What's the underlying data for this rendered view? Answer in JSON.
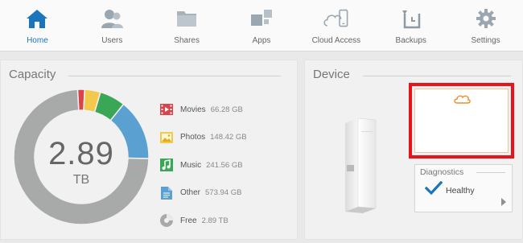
{
  "nav": [
    {
      "label": "Home",
      "icon": "home-icon",
      "active": true
    },
    {
      "label": "Users",
      "icon": "users-icon",
      "active": false
    },
    {
      "label": "Shares",
      "icon": "shares-icon",
      "active": false
    },
    {
      "label": "Apps",
      "icon": "apps-icon",
      "active": false
    },
    {
      "label": "Cloud Access",
      "icon": "cloud-access-icon",
      "active": false
    },
    {
      "label": "Backups",
      "icon": "backups-icon",
      "active": false
    },
    {
      "label": "Settings",
      "icon": "settings-icon",
      "active": false
    }
  ],
  "capacity": {
    "title": "Capacity",
    "total_value": "2.89",
    "total_unit": "TB",
    "segments": [
      {
        "name": "Movies",
        "size": "66.28 GB",
        "gb": 66.28,
        "color": "#d9434b",
        "icon": "movies-icon"
      },
      {
        "name": "Photos",
        "size": "148.42 GB",
        "gb": 148.42,
        "color": "#f2c94c",
        "icon": "photos-icon"
      },
      {
        "name": "Music",
        "size": "241.56 GB",
        "gb": 241.56,
        "color": "#3aa757",
        "icon": "music-icon"
      },
      {
        "name": "Other",
        "size": "573.94 GB",
        "gb": 573.94,
        "color": "#5aa0d0",
        "icon": "other-icon"
      },
      {
        "name": "Free",
        "size": "2.89 TB",
        "gb": 2890,
        "color": "#a7aaa8",
        "icon": "free-icon"
      }
    ]
  },
  "device": {
    "title": "Device",
    "diagnostics": {
      "title": "Diagnostics",
      "status": "Healthy"
    }
  },
  "colors": {
    "accent": "#1b75bc",
    "highlight": "#e8141a",
    "cloud": "#f28c28"
  }
}
